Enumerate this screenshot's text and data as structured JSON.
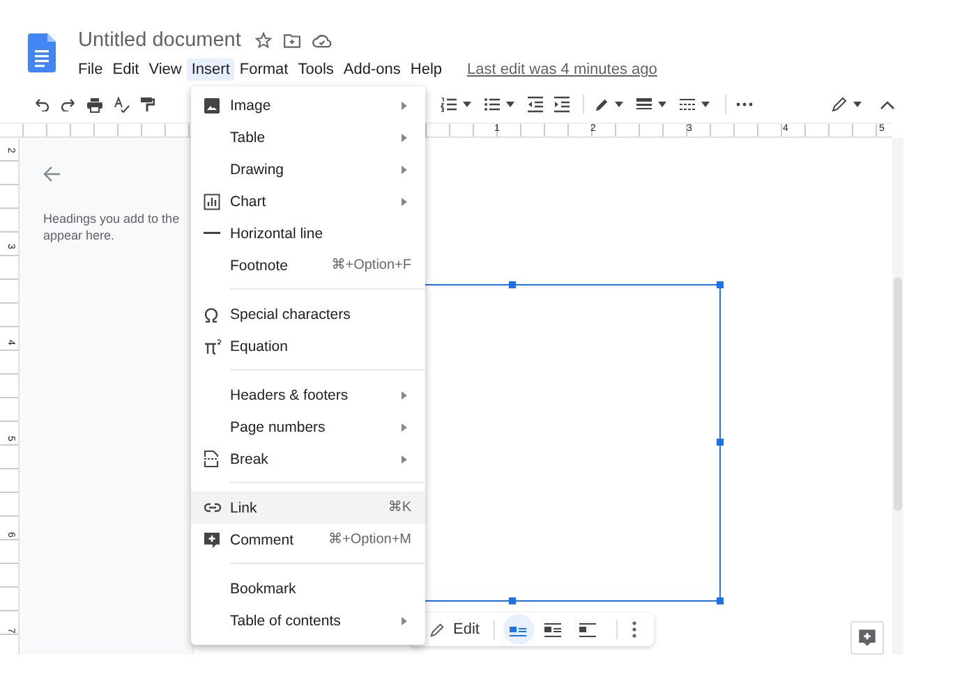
{
  "doc": {
    "title": "Untitled document"
  },
  "menu_bar": [
    {
      "label": "File",
      "selected": false
    },
    {
      "label": "Edit",
      "selected": false
    },
    {
      "label": "View",
      "selected": false
    },
    {
      "label": "Insert",
      "selected": true
    },
    {
      "label": "Format",
      "selected": false
    },
    {
      "label": "Tools",
      "selected": false
    },
    {
      "label": "Add-ons",
      "selected": false
    },
    {
      "label": "Help",
      "selected": false
    }
  ],
  "last_edit": "Last edit was 4 minutes ago",
  "ruler": {
    "h_numbers": [
      "1",
      "2",
      "3",
      "4",
      "5"
    ],
    "v_numbers": [
      "2",
      "3",
      "4",
      "5",
      "6",
      "7"
    ]
  },
  "outline": {
    "lines": [
      "Headings you add to the",
      "appear here."
    ]
  },
  "insert_menu": [
    {
      "kind": "item",
      "label": "Image",
      "submenu": true,
      "selected": false
    },
    {
      "kind": "item",
      "label": "Table",
      "submenu": true,
      "selected": false
    },
    {
      "kind": "item",
      "label": "Drawing",
      "submenu": true,
      "selected": false
    },
    {
      "kind": "item",
      "label": "Chart",
      "submenu": true,
      "selected": false
    },
    {
      "kind": "item",
      "label": "Horizontal line",
      "submenu": false,
      "selected": false
    },
    {
      "kind": "item",
      "label": "Footnote",
      "shortcut": "⌘+Option+F",
      "submenu": false,
      "selected": false
    },
    {
      "kind": "separator"
    },
    {
      "kind": "item",
      "label": "Special characters",
      "submenu": false,
      "selected": false
    },
    {
      "kind": "item",
      "label": "Equation",
      "submenu": false,
      "selected": false
    },
    {
      "kind": "separator"
    },
    {
      "kind": "item",
      "label": "Headers & footers",
      "submenu": true,
      "selected": false
    },
    {
      "kind": "item",
      "label": "Page numbers",
      "submenu": true,
      "selected": false
    },
    {
      "kind": "item",
      "label": "Break",
      "submenu": true,
      "selected": false
    },
    {
      "kind": "separator"
    },
    {
      "kind": "item",
      "label": "Link",
      "shortcut": "⌘K",
      "submenu": false,
      "selected": true
    },
    {
      "kind": "item",
      "label": "Comment",
      "shortcut": "⌘+Option+M",
      "submenu": false,
      "selected": false
    },
    {
      "kind": "separator"
    },
    {
      "kind": "item",
      "label": "Bookmark",
      "submenu": false,
      "selected": false
    },
    {
      "kind": "item",
      "label": "Table of contents",
      "submenu": true,
      "selected": false
    }
  ],
  "image_toolbar": {
    "edit_label": "Edit",
    "wrap_options": [
      {
        "selected": true
      },
      {
        "selected": false
      },
      {
        "selected": false
      }
    ]
  }
}
